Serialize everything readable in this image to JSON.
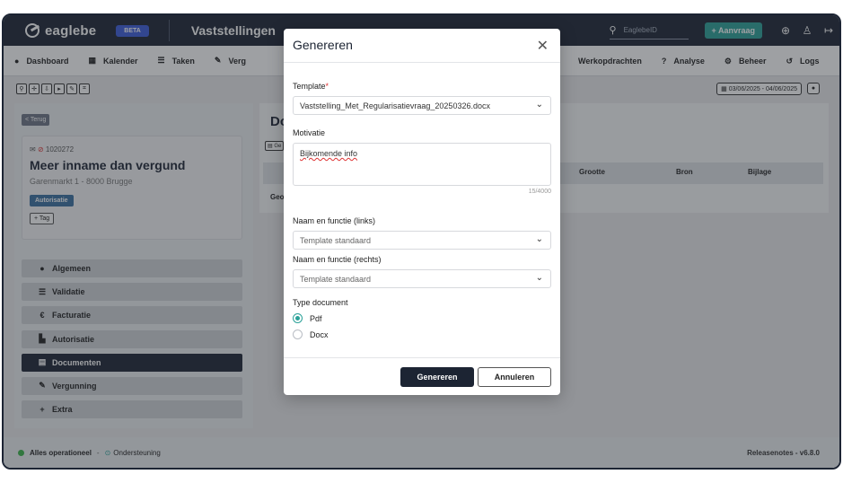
{
  "topbar": {
    "brand": "eaglebe",
    "beta": "BETA",
    "app_title": "Vaststellingen",
    "search_placeholder": "EaglebeID",
    "aanvraag_label": "Aanvraag",
    "icons": [
      "globe-icon",
      "user-icon",
      "logout-icon"
    ]
  },
  "nav": {
    "items": [
      {
        "label": "Dashboard",
        "icon": "●"
      },
      {
        "label": "Kalender",
        "icon": "▦"
      },
      {
        "label": "Taken",
        "icon": "☰"
      },
      {
        "label": "Verg",
        "icon": "✎"
      }
    ],
    "items_right": [
      {
        "label": "Werkopdrachten",
        "icon": ""
      },
      {
        "label": "Analyse",
        "icon": "?"
      },
      {
        "label": "Beheer",
        "icon": "⚙"
      },
      {
        "label": "Logs",
        "icon": "↺"
      }
    ]
  },
  "toolbar": {
    "date_range": "03/06/2025 - 04/06/2025"
  },
  "record": {
    "back_label": "< Terug",
    "id": "1020272",
    "title": "Meer inname dan vergund",
    "address": "Garenmarkt 1 - 8000 Brugge",
    "badge": "Autorisatie",
    "tag_label": "+ Tag"
  },
  "sidebar": {
    "items": [
      {
        "label": "Algemeen",
        "icon": "●"
      },
      {
        "label": "Validatie",
        "icon": "☰"
      },
      {
        "label": "Facturatie",
        "icon": "€"
      },
      {
        "label": "Autorisatie",
        "icon": "▙"
      },
      {
        "label": "Documenten",
        "icon": "▤"
      },
      {
        "label": "Vergunning",
        "icon": "✎"
      },
      {
        "label": "Extra",
        "icon": "+"
      }
    ]
  },
  "documents": {
    "title": "Do",
    "button": "Ge",
    "columns": [
      "Grootte",
      "Bron",
      "Bijlage"
    ],
    "row_label": "Geo"
  },
  "footer": {
    "status": "Alles operationeel",
    "separator": "-",
    "support": "Ondersteuning",
    "release": "Releasenotes - v6.8.0"
  },
  "modal": {
    "title": "Genereren",
    "template_label": "Template",
    "template_value": "Vaststelling_Met_Regularisatievraag_20250326.docx",
    "motivatie_label": "Motivatie",
    "motivatie_value": "Bijkomende info",
    "motivatie_counter": "15/4000",
    "naam_links_label": "Naam en functie (links)",
    "naam_links_value": "Template standaard",
    "naam_rechts_label": "Naam en functie (rechts)",
    "naam_rechts_value": "Template standaard",
    "type_label": "Type document",
    "type_options": [
      "Pdf",
      "Docx"
    ],
    "type_selected": "Pdf",
    "generate_button": "Genereren",
    "cancel_button": "Annuleren"
  },
  "colors": {
    "navy": "#1c2433",
    "teal": "#2aa198",
    "beta_blue": "#3b5bdb",
    "status_green": "#3bb54a"
  }
}
